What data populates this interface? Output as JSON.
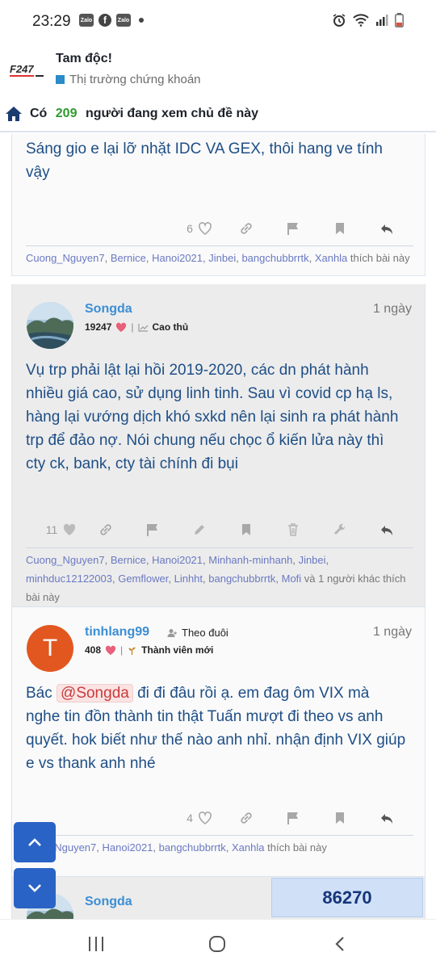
{
  "status_bar": {
    "time": "23:29",
    "notification_icons": [
      "zalo-icon",
      "facebook-icon",
      "zalo-icon",
      "dot-icon"
    ],
    "zalo_label": "Zalo",
    "system_icons": [
      "alarm-icon",
      "wifi-icon",
      "signal-icon",
      "battery-icon"
    ]
  },
  "header": {
    "logo_text": "F247",
    "thread_title": "Tam độc!",
    "forum_name": "Thị trường chứng khoán",
    "forum_color": "#2a8bc9"
  },
  "viewing": {
    "prefix": "Có",
    "count": "209",
    "suffix": "người đang xem chủ đề này"
  },
  "posts": [
    {
      "body": "Sáng gio e lại lỡ nhặt IDC VA GEX, thôi hang ve tính vậy",
      "like_count": "6",
      "likers": [
        "Cuong_Nguyen7",
        "Bernice",
        "Hanoi2021",
        "Jinbei",
        "bangchubbrrtk",
        "Xanhla"
      ],
      "likers_suffix": "thích bài này"
    },
    {
      "author": "Songda",
      "time": "1 ngày",
      "likes_total": "19247",
      "rank": "Cao thủ",
      "body": "Vụ trp phải lật lại hồi 2019-2020, các dn phát hành nhiều giá cao, sử dụng linh tinh. Sau vì covid cp hạ ls, hàng lại vướng dịch khó sxkd nên lại sinh ra phát hành trp để đảo nợ. Nói chung nếu chọc ổ kiến lửa này thì cty ck, bank, cty tài chính đi bụi",
      "like_count": "11",
      "likers": [
        "Cuong_Nguyen7",
        "Bernice",
        "Hanoi2021",
        "Minhanh-minhanh",
        "Jinbei",
        "minhduc12122003",
        "Gemflower",
        "Linhht",
        "bangchubbrrtk",
        "Mofi"
      ],
      "likers_more": "và 1 người khác",
      "likers_suffix": "thích bài này"
    },
    {
      "author": "tinhlang99",
      "avatar_letter": "T",
      "follow_label": "Theo đuôi",
      "time": "1 ngày",
      "likes_total": "408",
      "rank": "Thành viên mới",
      "body_prefix": "Bác",
      "mention": "@Songda",
      "body": "đi đi đâu rồi ạ. em đag ôm VIX mà nghe tin đồn thành tin thật Tuấn mượt đi theo vs anh quyết. hok biết như thế nào anh nhỉ. nhận định VIX giúp e vs thank anh nhé",
      "like_count": "4",
      "likers": [
        "Cuong_Nguyen7",
        "Hanoi2021",
        "bangchubbrrtk",
        "Xanhla"
      ],
      "likers_visible": [
        "_Nguyen7",
        "Hanoi2021",
        "bangchubbrrtk",
        "Xanhla"
      ],
      "likers_suffix": "thích bài này"
    },
    {
      "author": "Songda"
    }
  ],
  "counter": "86270",
  "colors": {
    "link": "#3b8ed4",
    "body_text": "#1e4e86",
    "count_green": "#2f9a2f",
    "fab_blue": "#2a63c6",
    "avatar_orange": "#e2571f"
  }
}
